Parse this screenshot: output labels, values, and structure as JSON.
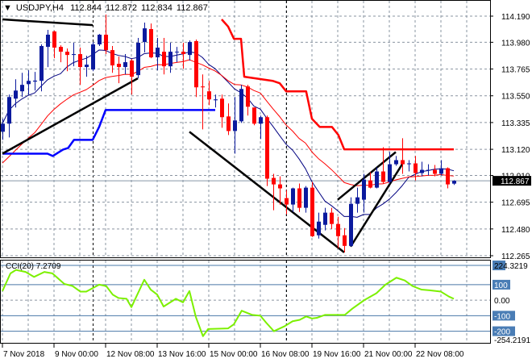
{
  "header": {
    "symbol_timeframe": "USDJPY,H4",
    "open": "112.844",
    "high": "112.872",
    "low": "112.834",
    "close": "112.867"
  },
  "chart_data": {
    "type": "candlestick",
    "title": "USDJPY,H4",
    "colors": {
      "bull": "#0b1a9e",
      "bear": "#ff0000",
      "ma_fast": "#000080",
      "ma_slow": "#ff0000",
      "upper_channel": "#ff0000",
      "lower_channel": "#0000ff",
      "trendline": "#000000",
      "cci": "#7cf000",
      "bid_box": "#000000",
      "level_box": "#4a7db5"
    },
    "y_ticks": [
      "114.190",
      "113.980",
      "113.765",
      "113.550",
      "113.335",
      "113.120",
      "112.910",
      "112.695",
      "112.480",
      "112.265"
    ],
    "y_range": [
      112.265,
      114.19
    ],
    "current_price": "112.867",
    "x_tick_labels": [
      "7 Nov 2018",
      "9 Nov 00:00",
      "12 Nov 08:00",
      "13 Nov 16:00",
      "15 Nov 00:00",
      "16 Nov 08:00",
      "19 Nov 16:00",
      "21 Nov 00:00",
      "22 Nov 08:00"
    ],
    "x_tick_candle_index": [
      0,
      8,
      16,
      24,
      32,
      40,
      48,
      56,
      64
    ],
    "candles_ohlc": [
      [
        113.261,
        113.365,
        113.196,
        113.326
      ],
      [
        113.326,
        113.56,
        113.215,
        113.54
      ],
      [
        113.527,
        113.683,
        113.456,
        113.592
      ],
      [
        113.586,
        113.735,
        113.54,
        113.638
      ],
      [
        113.644,
        113.755,
        113.56,
        113.67
      ],
      [
        113.664,
        113.742,
        113.592,
        113.672
      ],
      [
        113.67,
        113.963,
        113.586,
        113.95
      ],
      [
        113.943,
        114.08,
        113.781,
        114.041
      ],
      [
        114.067,
        114.073,
        113.852,
        113.937
      ],
      [
        113.943,
        113.956,
        113.82,
        113.904
      ],
      [
        113.904,
        113.93,
        113.748,
        113.878
      ],
      [
        113.878,
        113.976,
        113.787,
        113.885
      ],
      [
        113.885,
        113.937,
        113.638,
        113.781
      ],
      [
        113.781,
        113.872,
        113.703,
        113.8
      ],
      [
        113.761,
        113.982,
        113.748,
        113.963
      ],
      [
        113.963,
        114.047,
        113.95,
        114.041
      ],
      [
        114.041,
        114.203,
        113.885,
        113.917
      ],
      [
        113.917,
        113.95,
        113.735,
        113.794
      ],
      [
        113.807,
        113.865,
        113.651,
        113.781
      ],
      [
        113.781,
        113.885,
        113.722,
        113.82
      ],
      [
        113.833,
        113.846,
        113.56,
        113.703
      ],
      [
        113.716,
        114.015,
        113.69,
        113.976
      ],
      [
        113.982,
        114.138,
        113.898,
        114.092
      ],
      [
        114.086,
        114.131,
        113.852,
        113.859
      ],
      [
        113.859,
        114.015,
        113.755,
        113.937
      ],
      [
        113.904,
        114.015,
        113.722,
        113.787
      ],
      [
        113.787,
        113.976,
        113.735,
        113.904
      ],
      [
        113.898,
        113.943,
        113.82,
        113.904
      ],
      [
        113.904,
        113.976,
        113.768,
        113.885
      ],
      [
        113.878,
        113.995,
        113.833,
        113.982
      ],
      [
        113.989,
        114.002,
        113.54,
        113.618
      ],
      [
        113.625,
        113.722,
        113.28,
        113.618
      ],
      [
        113.586,
        113.67,
        113.475,
        113.521
      ],
      [
        113.514,
        113.56,
        113.456,
        113.521
      ],
      [
        113.527,
        113.56,
        113.293,
        113.378
      ],
      [
        113.384,
        113.488,
        113.235,
        113.267
      ],
      [
        113.267,
        113.54,
        113.085,
        113.352
      ],
      [
        113.345,
        113.638,
        113.332,
        113.605
      ],
      [
        113.625,
        113.638,
        113.391,
        113.462
      ],
      [
        113.456,
        113.456,
        113.313,
        113.326
      ],
      [
        113.326,
        113.391,
        113.202,
        113.378
      ],
      [
        113.378,
        113.391,
        112.825,
        112.884
      ],
      [
        112.89,
        112.923,
        112.63,
        112.838
      ],
      [
        112.838,
        112.903,
        112.676,
        112.806
      ],
      [
        112.728,
        112.792,
        112.598,
        112.676
      ],
      [
        112.676,
        112.812,
        112.617,
        112.806
      ],
      [
        112.806,
        112.845,
        112.617,
        112.65
      ],
      [
        112.65,
        112.825,
        112.611,
        112.812
      ],
      [
        112.812,
        112.858,
        112.416,
        112.422
      ],
      [
        112.429,
        112.611,
        112.403,
        112.539
      ],
      [
        112.513,
        112.65,
        112.468,
        112.611
      ],
      [
        112.611,
        112.65,
        112.48,
        112.52
      ],
      [
        112.52,
        112.578,
        112.325,
        112.422
      ],
      [
        112.429,
        112.487,
        112.292,
        112.344
      ],
      [
        112.344,
        112.734,
        112.338,
        112.682
      ],
      [
        112.682,
        112.812,
        112.611,
        112.734
      ],
      [
        112.715,
        112.923,
        112.611,
        112.877
      ],
      [
        112.87,
        112.936,
        112.806,
        112.812
      ],
      [
        112.812,
        112.975,
        112.806,
        112.942
      ],
      [
        112.942,
        113.137,
        112.845,
        112.858
      ],
      [
        112.858,
        113.098,
        112.845,
        113.0
      ],
      [
        113.0,
        113.066,
        112.988,
        113.033
      ],
      [
        113.033,
        113.209,
        112.923,
        113.0
      ],
      [
        113.0,
        113.033,
        112.942,
        113.007
      ],
      [
        113.007,
        113.066,
        112.87,
        112.929
      ],
      [
        112.929,
        113.02,
        112.903,
        112.955
      ],
      [
        112.949,
        113.0,
        112.91,
        112.955
      ],
      [
        112.955,
        112.994,
        112.903,
        112.923
      ],
      [
        112.923,
        113.033,
        112.91,
        112.968
      ],
      [
        112.968,
        112.975,
        112.806,
        112.838
      ],
      [
        112.844,
        112.872,
        112.834,
        112.867
      ]
    ],
    "upper_channel": [
      [
        34,
        114.164
      ],
      [
        35,
        114.106
      ],
      [
        35.9,
        114.008
      ],
      [
        37,
        114.008
      ],
      [
        37.5,
        113.703
      ],
      [
        41.9,
        113.67
      ],
      [
        43,
        113.651
      ],
      [
        44,
        113.586
      ],
      [
        47.1,
        113.586
      ],
      [
        48,
        113.365
      ],
      [
        49.2,
        113.3
      ],
      [
        51.1,
        113.3
      ],
      [
        52.1,
        113.235
      ],
      [
        53,
        113.12
      ],
      [
        70,
        113.12
      ]
    ],
    "lower_channel": [
      [
        0,
        113.085
      ],
      [
        7,
        113.085
      ],
      [
        7.8,
        113.066
      ],
      [
        9.4,
        113.118
      ],
      [
        10.2,
        113.131
      ],
      [
        11.1,
        113.196
      ],
      [
        14,
        113.196
      ],
      [
        15,
        113.3
      ],
      [
        16,
        113.436
      ],
      [
        33,
        113.436
      ]
    ],
    "trendlines": [
      [
        [
          0,
          114.164
        ],
        [
          2.1,
          114.157
        ],
        [
          14,
          114.118
        ]
      ],
      [
        [
          0,
          113.085
        ],
        [
          21,
          113.69
        ]
      ],
      [
        [
          29,
          113.261
        ],
        [
          53,
          112.292
        ]
      ],
      [
        [
          52,
          112.715
        ],
        [
          61,
          113.098
        ]
      ],
      [
        [
          54,
          112.338
        ],
        [
          62,
          113.0
        ]
      ]
    ],
    "cci": {
      "label": "CCI(20)",
      "value": "7.2709",
      "axis_labels": [
        "224.3219",
        "100",
        "0.00",
        "-100",
        "-200",
        "-254.2191"
      ],
      "range": [
        -254.2191,
        224.3219
      ],
      "levels": [
        100,
        -100,
        -200,
        224.3219
      ],
      "points": [
        [
          0,
          59
        ],
        [
          1.25,
          173
        ],
        [
          2.1,
          195
        ],
        [
          3.6,
          182
        ],
        [
          4.9,
          150
        ],
        [
          6.5,
          182
        ],
        [
          7.75,
          173
        ],
        [
          9.6,
          105
        ],
        [
          10.9,
          91
        ],
        [
          12.1,
          55
        ],
        [
          13,
          55
        ],
        [
          15,
          100
        ],
        [
          16.1,
          91
        ],
        [
          17.1,
          36
        ],
        [
          18,
          14
        ],
        [
          19.25,
          9
        ],
        [
          20,
          -45
        ],
        [
          22,
          132
        ],
        [
          23,
          68
        ],
        [
          24,
          36
        ],
        [
          25,
          -41
        ],
        [
          26.9,
          9
        ],
        [
          28,
          -14
        ],
        [
          29,
          59
        ],
        [
          30,
          -109
        ],
        [
          31.1,
          -232
        ],
        [
          31.9,
          -186
        ],
        [
          35,
          -182
        ],
        [
          35.9,
          -155
        ],
        [
          37.1,
          -68
        ],
        [
          38.75,
          -95
        ],
        [
          40,
          -100
        ],
        [
          40.9,
          -145
        ],
        [
          42.1,
          -200
        ],
        [
          43.75,
          -168
        ],
        [
          45,
          -136
        ],
        [
          46.1,
          -127
        ],
        [
          47.1,
          -105
        ],
        [
          48,
          -118
        ],
        [
          48.75,
          -114
        ],
        [
          50,
          -95
        ],
        [
          53.1,
          -95
        ],
        [
          54.25,
          -55
        ],
        [
          56.1,
          0
        ],
        [
          58,
          45
        ],
        [
          59.4,
          100
        ],
        [
          61.1,
          145
        ],
        [
          62.4,
          127
        ],
        [
          63.6,
          91
        ],
        [
          65,
          68
        ],
        [
          66.25,
          64
        ],
        [
          68,
          55
        ],
        [
          69.25,
          23
        ],
        [
          70,
          9
        ]
      ]
    }
  }
}
